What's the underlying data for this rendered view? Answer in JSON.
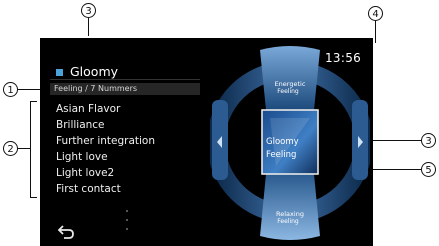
{
  "callouts": {
    "num1": "1",
    "num2": "2",
    "num3": "3",
    "num4": "4",
    "num5": "5"
  },
  "screen": {
    "title": "Gloomy",
    "subtitle": "Feeling / 7 Nummers",
    "clock": "13:56",
    "songs": [
      "Asian Flavor",
      "Brilliance",
      "Further integration",
      "Light love",
      "Light love2",
      "First contact"
    ],
    "back_icon": "back-arrow-icon",
    "mood_wheel": {
      "top_label_line1": "Energetic",
      "top_label_line2": "Feeling",
      "selected_line1": "Gloomy",
      "selected_line2": "Feeling",
      "bottom_label_line1": "Relaxing",
      "bottom_label_line2": "Feeling"
    },
    "colors": {
      "accent": "#4aa3d9",
      "background": "#000000",
      "text": "#ffffff"
    }
  }
}
